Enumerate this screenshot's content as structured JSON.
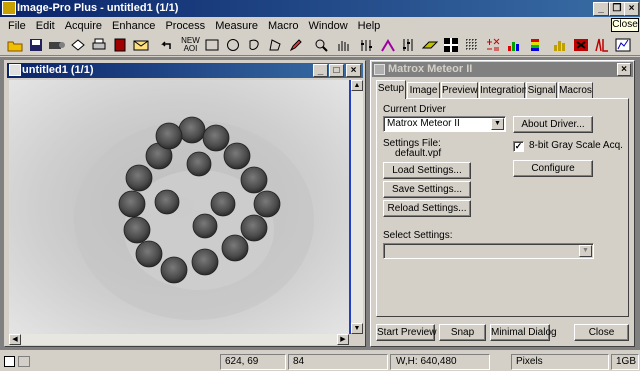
{
  "app": {
    "title": "Image-Pro Plus - untitled1 (1/1)",
    "caption_buttons": [
      "_",
      "3",
      "×"
    ]
  },
  "tooltip": "Close",
  "menu": [
    "File",
    "Edit",
    "Acquire",
    "Enhance",
    "Process",
    "Measure",
    "Macro",
    "Window",
    "Help"
  ],
  "toolbar": {
    "new_aoi_label": [
      "NEW",
      "AOI"
    ],
    "icons": [
      "open-icon",
      "save-icon",
      "camera-icon",
      "undo-icon",
      "print-icon",
      "book-icon",
      "envelope-icon"
    ]
  },
  "image_window": {
    "title": "untitled1 (1/1)"
  },
  "dialog": {
    "title": "Matrox Meteor II",
    "tabs": [
      "Setup",
      "Image",
      "Preview",
      "Integration",
      "Signal",
      "Macros"
    ],
    "active_tab": "Setup",
    "current_driver_label": "Current Driver",
    "driver_value": "Matrox Meteor II",
    "about_driver": "About Driver...",
    "settings_file_label": "Settings File:",
    "settings_file_value": "default.vpf",
    "checkbox_label": "8-bit Gray Scale Acq.",
    "checkbox_checked": true,
    "configure": "Configure",
    "load_settings": "Load Settings...",
    "save_settings": "Save Settings...",
    "reload_settings": "Reload Settings...",
    "select_settings_label": "Select Settings:",
    "select_settings_value": "",
    "start_preview": "Start Preview",
    "snap": "Snap",
    "minimal_dialog": "Minimal Dialog",
    "close": "Close"
  },
  "status": {
    "coords": "624,  69",
    "value": "84",
    "empty": "",
    "size": "W,H: 640,480",
    "units": "Pixels",
    "memory": "1GB"
  }
}
